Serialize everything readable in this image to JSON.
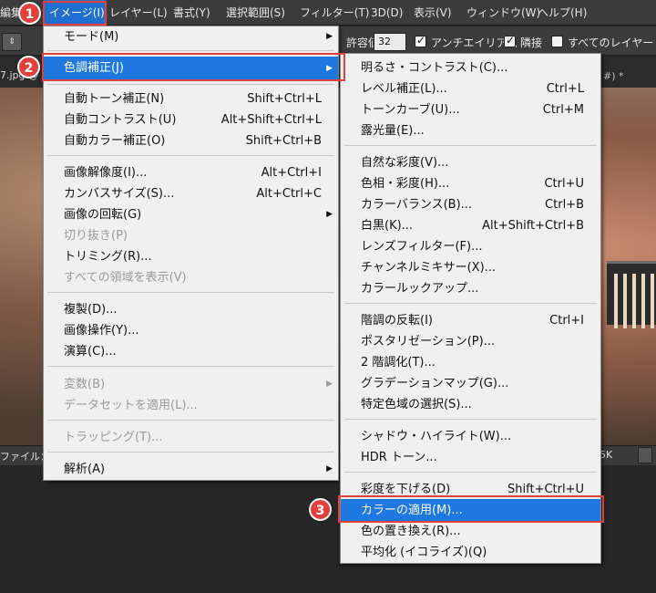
{
  "menubar": {
    "items": [
      {
        "label": "編集"
      },
      {
        "label": "イメージ(I)"
      },
      {
        "label": "レイヤー(L)"
      },
      {
        "label": "書式(Y)"
      },
      {
        "label": "選択範囲(S)"
      },
      {
        "label": "フィルター(T)"
      },
      {
        "label": "3D(D)"
      },
      {
        "label": "表示(V)"
      },
      {
        "label": "ウィンドウ(W)"
      },
      {
        "label": "ヘルプ(H)"
      }
    ]
  },
  "options": {
    "tolerance_label": "許容値：",
    "tolerance_value": "32",
    "antialias_label": "アンチエイリアス",
    "contiguous_label": "隣接",
    "all_layers_label": "すべてのレイヤー"
  },
  "document": {
    "tab_title": "7.jpg @",
    "tab_title_right": "#) *",
    "status_label": "ファイル：",
    "status_right": "5K"
  },
  "image_menu": {
    "items": [
      {
        "label": "モード(M)",
        "shortcut": "",
        "submenu": true
      },
      {
        "label": "色調補正(J)",
        "shortcut": "",
        "submenu": true,
        "highlighted": true
      },
      {
        "label": "自動トーン補正(N)",
        "shortcut": "Shift+Ctrl+L"
      },
      {
        "label": "自動コントラスト(U)",
        "shortcut": "Alt+Shift+Ctrl+L"
      },
      {
        "label": "自動カラー補正(O)",
        "shortcut": "Shift+Ctrl+B"
      },
      {
        "label": "画像解像度(I)...",
        "shortcut": "Alt+Ctrl+I"
      },
      {
        "label": "カンバスサイズ(S)...",
        "shortcut": "Alt+Ctrl+C"
      },
      {
        "label": "画像の回転(G)",
        "shortcut": "",
        "submenu": true
      },
      {
        "label": "切り抜き(P)",
        "shortcut": "",
        "disabled": true
      },
      {
        "label": "トリミング(R)...",
        "shortcut": ""
      },
      {
        "label": "すべての領域を表示(V)",
        "shortcut": "",
        "disabled": true
      },
      {
        "label": "複製(D)...",
        "shortcut": ""
      },
      {
        "label": "画像操作(Y)...",
        "shortcut": ""
      },
      {
        "label": "演算(C)...",
        "shortcut": ""
      },
      {
        "label": "変数(B)",
        "shortcut": "",
        "submenu": true,
        "disabled": true
      },
      {
        "label": "データセットを適用(L)...",
        "shortcut": "",
        "disabled": true
      },
      {
        "label": "トラッピング(T)...",
        "shortcut": "",
        "disabled": true
      },
      {
        "label": "解析(A)",
        "shortcut": "",
        "submenu": true
      }
    ]
  },
  "adjust_menu": {
    "items": [
      {
        "label": "明るさ・コントラスト(C)...",
        "shortcut": ""
      },
      {
        "label": "レベル補正(L)...",
        "shortcut": "Ctrl+L"
      },
      {
        "label": "トーンカーブ(U)...",
        "shortcut": "Ctrl+M"
      },
      {
        "label": "露光量(E)...",
        "shortcut": ""
      },
      {
        "label": "自然な彩度(V)...",
        "shortcut": ""
      },
      {
        "label": "色相・彩度(H)...",
        "shortcut": "Ctrl+U"
      },
      {
        "label": "カラーバランス(B)...",
        "shortcut": "Ctrl+B"
      },
      {
        "label": "白黒(K)...",
        "shortcut": "Alt+Shift+Ctrl+B"
      },
      {
        "label": "レンズフィルター(F)...",
        "shortcut": ""
      },
      {
        "label": "チャンネルミキサー(X)...",
        "shortcut": ""
      },
      {
        "label": "カラールックアップ...",
        "shortcut": ""
      },
      {
        "label": "階調の反転(I)",
        "shortcut": "Ctrl+I"
      },
      {
        "label": "ポスタリゼーション(P)...",
        "shortcut": ""
      },
      {
        "label": "2 階調化(T)...",
        "shortcut": ""
      },
      {
        "label": "グラデーションマップ(G)...",
        "shortcut": ""
      },
      {
        "label": "特定色域の選択(S)...",
        "shortcut": ""
      },
      {
        "label": "シャドウ・ハイライト(W)...",
        "shortcut": ""
      },
      {
        "label": "HDR トーン...",
        "shortcut": ""
      },
      {
        "label": "彩度を下げる(D)",
        "shortcut": "Shift+Ctrl+U"
      },
      {
        "label": "カラーの適用(M)...",
        "shortcut": "",
        "highlighted": true
      },
      {
        "label": "色の置き換え(R)...",
        "shortcut": ""
      },
      {
        "label": "平均化 (イコライズ)(Q)",
        "shortcut": ""
      }
    ]
  },
  "callouts": [
    "1",
    "2",
    "3"
  ],
  "colors": {
    "accent": "#1f77e0",
    "callout": "#e2403c"
  }
}
